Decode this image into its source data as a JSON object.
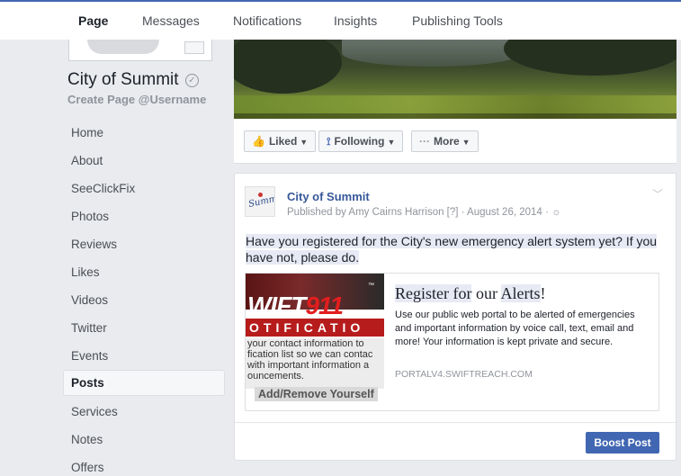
{
  "topnav": {
    "tabs": [
      {
        "label": "Page",
        "active": true
      },
      {
        "label": "Messages"
      },
      {
        "label": "Notifications"
      },
      {
        "label": "Insights"
      },
      {
        "label": "Publishing Tools"
      }
    ]
  },
  "page": {
    "name": "City of Summit",
    "verified_icon": "check-circle-icon",
    "username_cta": "Create Page @Username"
  },
  "sidebar": {
    "items": [
      {
        "label": "Home"
      },
      {
        "label": "About"
      },
      {
        "label": "SeeClickFix"
      },
      {
        "label": "Photos"
      },
      {
        "label": "Reviews"
      },
      {
        "label": "Likes"
      },
      {
        "label": "Videos"
      },
      {
        "label": "Twitter"
      },
      {
        "label": "Events"
      },
      {
        "label": "Posts",
        "active": true
      },
      {
        "label": "Services"
      },
      {
        "label": "Notes"
      },
      {
        "label": "Offers"
      }
    ]
  },
  "actions": {
    "liked": "Liked",
    "following": "Following",
    "more": "More"
  },
  "post": {
    "author": "City of Summit",
    "meta": "Published by Amy Cairns Harrison [?] · August 26, 2014 ·",
    "text": "Have you registered for the City's new emergency alert system yet? If you have not, please do.",
    "link": {
      "image": {
        "logo_a": "WIFT",
        "logo_b": "911",
        "tm": "™",
        "band": "OTIFICATIO",
        "small": "your contact information to\nfication list so we can contac\nwith important information a\nouncements.",
        "button": "Add/Remove Yourself"
      },
      "title_a": "Register for",
      "title_b": " our ",
      "title_c": "Alerts",
      "title_d": "!",
      "description": "Use our public web portal to be alerted of emergencies and important information by voice call, text, email and more! Your information is kept private and secure.",
      "domain": "PORTALV4.SWIFTREACH.COM"
    },
    "boost_label": "Boost Post"
  },
  "colors": {
    "brand": "#4267b2",
    "link": "#365899"
  }
}
